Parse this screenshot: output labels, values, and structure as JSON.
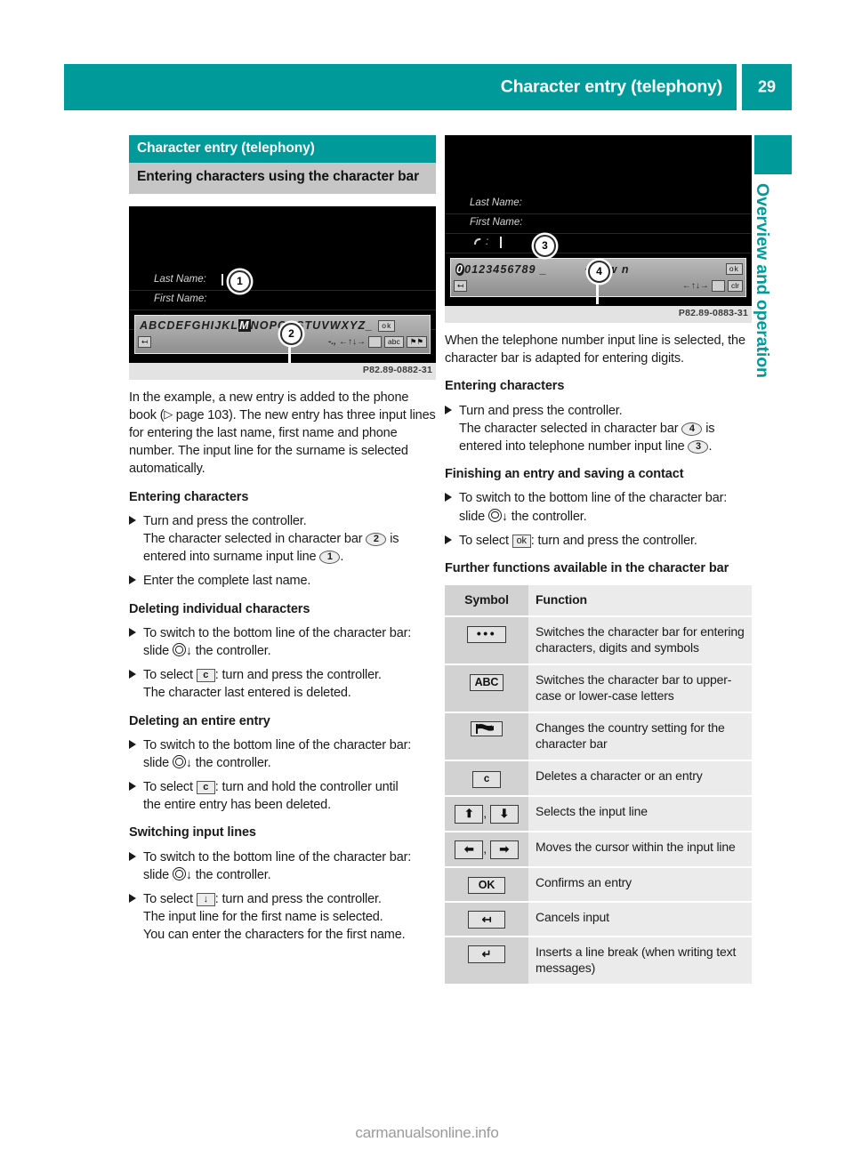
{
  "header": {
    "title": "Character entry (telephony)",
    "page_number": "29"
  },
  "side_tab": {
    "label": "Overview and operation"
  },
  "left_column": {
    "section_heading": "Character entry (telephony)",
    "sub_heading": "Entering characters using the character bar",
    "figure": {
      "caption": "P82.89-0882-31",
      "screen_labels": {
        "last_name": "Last Name:",
        "first_name": "First Name:",
        "phone": ":"
      },
      "callouts": [
        "1",
        "2"
      ],
      "char_bar_letters_a": "ABCDEFGHIJKL",
      "char_bar_letters_highlight": "M",
      "char_bar_letters_b": "NOPQRSTUVWXYZ",
      "char_bar_trailing": "_",
      "char_bar_ok": "ok",
      "char_bar_symbols": "-.,",
      "char_bar_keys": [
        "ABC",
        "flag"
      ]
    },
    "intro_paragraph_part1": "In the example, a new entry is added to the phone book (",
    "intro_paragraph_page_ref": "page 103",
    "intro_paragraph_part2": "). The new entry has three input lines for entering the last name, first name and phone number. The input line for the surname is selected automatically.",
    "h_entering": "Entering characters",
    "step_entering_1": "Turn and press the controller.",
    "step_entering_1_cont_a": "The character selected in character bar",
    "step_entering_1_cont_b": "is entered into surname input line",
    "step_entering_1_cont_end": ".",
    "step_entering_2": "Enter the complete last name.",
    "h_deleting_individual": "Deleting individual characters",
    "step_switch_bottom_a": "To switch to the bottom line of the character bar: slide",
    "step_switch_bottom_b": "the controller.",
    "step_select_prefix": "To select",
    "step_select_suffix": ": turn and press the controller.",
    "step_del_char_cont": "The character last entered is deleted.",
    "h_deleting_entire": "Deleting an entire entry",
    "step_select_hold_suffix": ": turn and hold the controller until",
    "step_del_entry_cont": "the entire entry has been deleted.",
    "h_switching_lines": "Switching input lines",
    "step_switch_line_cont_a": "The input line for the first name is selected.",
    "step_switch_line_cont_b": "You can enter the characters for the first name.",
    "key_c": "c",
    "key_down": "↓"
  },
  "right_column": {
    "figure": {
      "caption": "P82.89-0883-31",
      "screen_labels": {
        "last_name": "Last Name:",
        "first_name": "First Name:",
        "phone": ":"
      },
      "callouts": [
        "3",
        "4"
      ],
      "char_bar_digits": "0123456789 _",
      "char_bar_letters": "+ p w n",
      "char_bar_ok": "ok"
    },
    "intro_paragraph": "When the telephone number input line is selected, the character bar is adapted for entering digits.",
    "h_entering": "Entering characters",
    "step_entering_1": "Turn and press the controller.",
    "step_entering_1_cont_a": "The character selected in character bar",
    "step_entering_1_cont_b": "is entered into telephone number input line",
    "step_entering_1_cont_end": ".",
    "h_finishing": "Finishing an entry and saving a contact",
    "step_switch_bottom_a": "To switch to the bottom line of the character bar: slide",
    "step_switch_bottom_b": "the controller.",
    "step_select_prefix": "To select",
    "step_select_suffix": ": turn and press the controller.",
    "key_ok": "ok",
    "h_further": "Further functions available in the character bar",
    "table": {
      "headers": [
        "Symbol",
        "Function"
      ],
      "rows": [
        {
          "symbol": "dots",
          "symbol_label": "•••",
          "function": "Switches the character bar for entering characters, digits and symbols"
        },
        {
          "symbol": "abc",
          "symbol_label": "ABC",
          "function": "Switches the character bar to upper-case or lower-case letters"
        },
        {
          "symbol": "flag",
          "symbol_label": "flag",
          "function": "Changes the country setting for the character bar"
        },
        {
          "symbol": "c",
          "symbol_label": "c",
          "function": "Deletes a character or an entry"
        },
        {
          "symbol": "updown",
          "symbol_label": "↑ , ↓",
          "function": "Selects the input line"
        },
        {
          "symbol": "leftright",
          "symbol_label": "← , →",
          "function": "Moves the cursor within the input line"
        },
        {
          "symbol": "ok",
          "symbol_label": "OK",
          "function": "Confirms an entry"
        },
        {
          "symbol": "cancel",
          "symbol_label": "↰",
          "function": "Cancels input"
        },
        {
          "symbol": "enter",
          "symbol_label": "↵",
          "function": "Inserts a line break (when writing text messages)"
        }
      ]
    }
  },
  "watermark": "carmanualsonline.info",
  "colors": {
    "teal": "#009a9a",
    "gray_heading": "#c6c6c6",
    "table_symbol_bg": "#d2d2d2",
    "table_function_bg": "#ebebeb"
  }
}
